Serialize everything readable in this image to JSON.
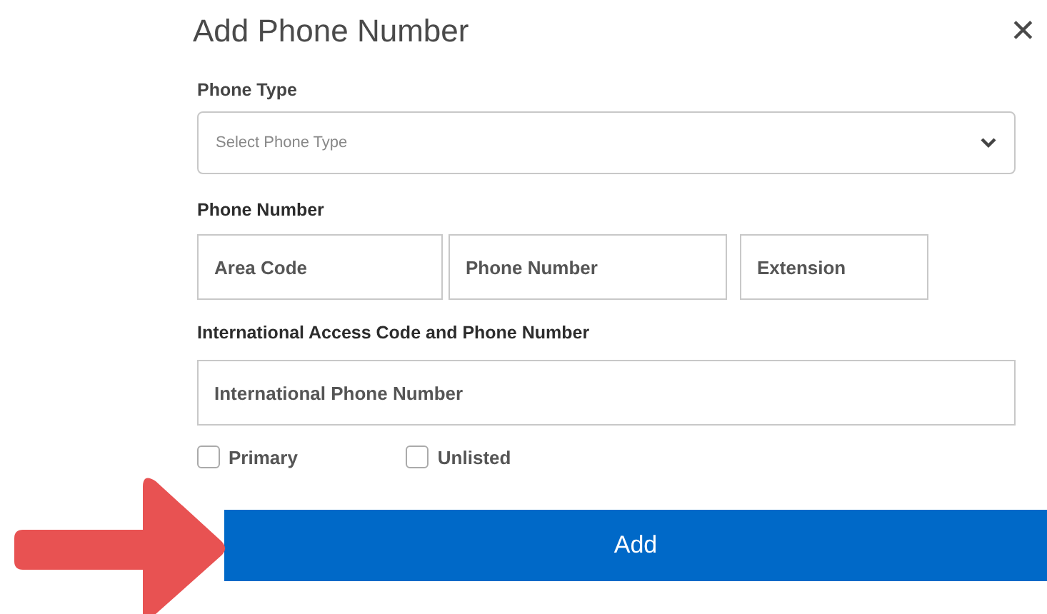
{
  "dialog": {
    "title": "Add Phone Number",
    "close": "✕"
  },
  "phone_type": {
    "label": "Phone Type",
    "placeholder": "Select Phone Type"
  },
  "phone_number": {
    "label": "Phone Number",
    "fields": [
      {
        "placeholder": "Area Code"
      },
      {
        "placeholder": "Phone Number"
      },
      {
        "placeholder": "Extension"
      }
    ]
  },
  "international": {
    "label": "International Access Code and Phone Number",
    "placeholder": "International Phone Number"
  },
  "options": [
    {
      "label": "Primary",
      "checked": false
    },
    {
      "label": "Unlisted",
      "checked": false
    }
  ],
  "submit": {
    "label": "Add"
  },
  "annotation": {
    "kind": "arrow"
  }
}
